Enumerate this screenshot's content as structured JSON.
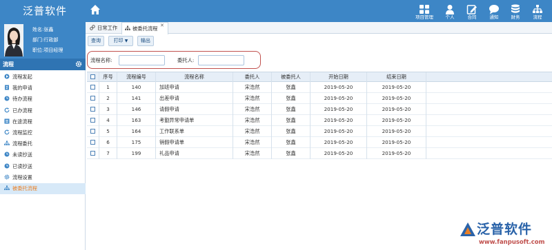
{
  "app": {
    "title": "泛普软件"
  },
  "header_nav": [
    {
      "label": "项目管理",
      "icon": "grid-icon"
    },
    {
      "label": "个人",
      "icon": "person-icon"
    },
    {
      "label": "合同",
      "icon": "edit-icon"
    },
    {
      "label": "通知",
      "icon": "chat-icon"
    },
    {
      "label": "财务",
      "icon": "database-icon"
    },
    {
      "label": "流程",
      "icon": "org-chart-icon"
    }
  ],
  "profile": {
    "name": "姓名:张鑫",
    "dept": "部门:行政部",
    "title": "职位:项目经理"
  },
  "sidebar": {
    "section_title": "流程",
    "items": [
      {
        "label": "流程发起",
        "icon": "launch-icon"
      },
      {
        "label": "我的申请",
        "icon": "doc-icon"
      },
      {
        "label": "待办流程",
        "icon": "clock-icon"
      },
      {
        "label": "已办流程",
        "icon": "refresh-icon"
      },
      {
        "label": "在途流程",
        "icon": "list-icon"
      },
      {
        "label": "流程监控",
        "icon": "refresh-icon"
      },
      {
        "label": "流程委托",
        "icon": "org-chart-icon"
      },
      {
        "label": "未读抄送",
        "icon": "clock-icon"
      },
      {
        "label": "已读抄送",
        "icon": "clock-icon"
      },
      {
        "label": "流程设置",
        "icon": "gear-icon"
      },
      {
        "label": "被委托流程",
        "icon": "org-chart-icon",
        "active": true
      }
    ]
  },
  "tabs": [
    {
      "label": "日常工作",
      "icon": "link-icon"
    },
    {
      "label": "被委托流程",
      "icon": "org-chart-icon",
      "active": true
    }
  ],
  "toolbar": {
    "query": "查询",
    "print": "打印",
    "export": "输出"
  },
  "search": {
    "process_name_label": "流程名称:",
    "process_name_value": "",
    "principal_label": "委托人:",
    "principal_value": ""
  },
  "table": {
    "columns": [
      "序号",
      "流程编号",
      "流程名称",
      "委托人",
      "被委托人",
      "开始日期",
      "结束日期"
    ],
    "rows": [
      [
        "1",
        "140",
        "加班申请",
        "宋浩然",
        "张鑫",
        "2019-05-20",
        "2019-05-20"
      ],
      [
        "2",
        "141",
        "出差申请",
        "宋浩然",
        "张鑫",
        "2019-05-20",
        "2019-05-20"
      ],
      [
        "3",
        "146",
        "请假申请",
        "宋浩然",
        "张鑫",
        "2019-05-20",
        "2019-05-20"
      ],
      [
        "4",
        "163",
        "考勤异常申请单",
        "宋浩然",
        "张鑫",
        "2019-05-20",
        "2019-05-20"
      ],
      [
        "5",
        "164",
        "工作联系单",
        "宋浩然",
        "张鑫",
        "2019-05-20",
        "2019-05-20"
      ],
      [
        "6",
        "175",
        "销假申请单",
        "宋浩然",
        "张鑫",
        "2019-05-20",
        "2019-05-20"
      ],
      [
        "7",
        "199",
        "礼品申请",
        "宋浩然",
        "张鑫",
        "2019-05-20",
        "2019-05-20"
      ]
    ]
  },
  "watermark": {
    "brand": "泛普软件",
    "url": "www.fanpusoft.com"
  },
  "colors": {
    "header": "#3d86c6",
    "section": "#2f74b3",
    "active_text": "#e97f25",
    "highlight": "#c0504d"
  }
}
